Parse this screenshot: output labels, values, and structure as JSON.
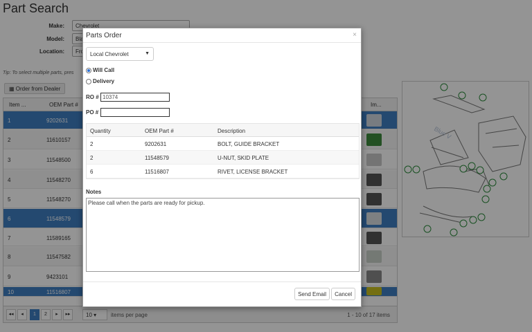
{
  "page": {
    "title": "Part Search",
    "make_label": "Make:",
    "make_value": "Chevrolet",
    "model_label": "Model:",
    "model_value": "Bla",
    "location_label": "Location:",
    "location_value": "Fro",
    "tip": "Tip: To select multiple parts, pres",
    "order_button": "Order from Dealer",
    "grid": {
      "col_item": "Item ...",
      "col_oem": "OEM Part #",
      "col_image": "Im...",
      "rows": [
        {
          "item": "1",
          "oem": "9202631",
          "selected": true
        },
        {
          "item": "2",
          "oem": "11610157",
          "selected": false
        },
        {
          "item": "3",
          "oem": "11548500",
          "selected": false
        },
        {
          "item": "4",
          "oem": "11548270",
          "selected": false
        },
        {
          "item": "5",
          "oem": "11548270",
          "selected": false
        },
        {
          "item": "6",
          "oem": "11548579",
          "selected": true
        },
        {
          "item": "7",
          "oem": "11589165",
          "selected": false
        },
        {
          "item": "8",
          "oem": "11547582",
          "selected": false
        },
        {
          "item": "9",
          "oem": "9423101",
          "selected": false
        },
        {
          "item": "10",
          "oem": "11516807",
          "selected": true
        }
      ]
    },
    "pager": {
      "first": "◂◂",
      "prev": "◂",
      "page1": "1",
      "page2": "2",
      "next": "▸",
      "last": "▸▸",
      "per_page_value": "10",
      "per_page_label": "items per page",
      "range": "1 - 10 of 17 items"
    }
  },
  "modal": {
    "title": "Parts Order",
    "close": "×",
    "dealer": "Local Chevrolet",
    "will_call": "Will Call",
    "delivery": "Delivery",
    "ro_label": "RO #",
    "ro_value": "10374",
    "po_label": "PO #",
    "po_value": "",
    "table": {
      "col_qty": "Quantity",
      "col_oem": "OEM Part #",
      "col_desc": "Description",
      "rows": [
        {
          "qty": "2",
          "oem": "9202631",
          "desc": "BOLT, GUIDE BRACKET"
        },
        {
          "qty": "2",
          "oem": "11548579",
          "desc": "U-NUT, SKID PLATE"
        },
        {
          "qty": "6",
          "oem": "11516807",
          "desc": "RIVET, LICENSE BRACKET"
        }
      ]
    },
    "notes_label": "Notes",
    "notes_value": "Please call when the parts are ready for pickup.",
    "send_email": "Send Email",
    "cancel": "Cancel"
  }
}
